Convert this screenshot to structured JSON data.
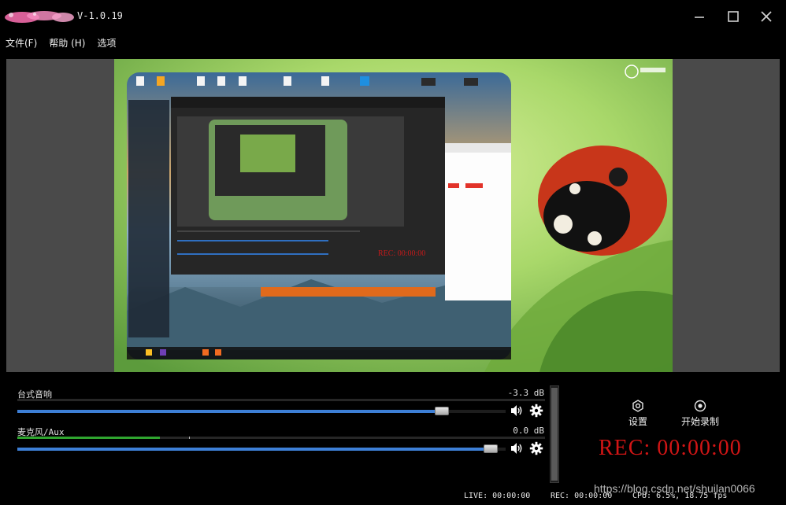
{
  "app": {
    "version": "V-1.0.19",
    "window_controls": [
      "minimize-icon",
      "maximize-icon",
      "close-icon"
    ]
  },
  "menu": {
    "items": [
      {
        "label": "文件(F)"
      },
      {
        "label": "帮助 (H)"
      },
      {
        "label": "选项"
      }
    ]
  },
  "preview": {
    "description": "live capture preview"
  },
  "audio": {
    "channels": [
      {
        "name": "台式音响",
        "db": "-3.3 dB",
        "meter_level": 0.0,
        "volume": 0.87
      },
      {
        "name": "麦克风/Aux",
        "db": "0.0 dB",
        "meter_level": 0.27,
        "volume": 0.97
      }
    ]
  },
  "actions": {
    "settings_label": "设置",
    "record_label": "开始录制"
  },
  "recording": {
    "rec_time": "REC: 00:00:00"
  },
  "status": {
    "live": "LIVE: 00:00:00",
    "rec": "REC: 00:00:00",
    "cpu": "CPU: 6.5%, 18.75 fps"
  },
  "watermark": "https://blog.csdn.net/shuilan0066",
  "colors": {
    "rec_red": "#d11515",
    "slider_blue": "#3d7fd6",
    "meter_green": "#2fa52f"
  }
}
